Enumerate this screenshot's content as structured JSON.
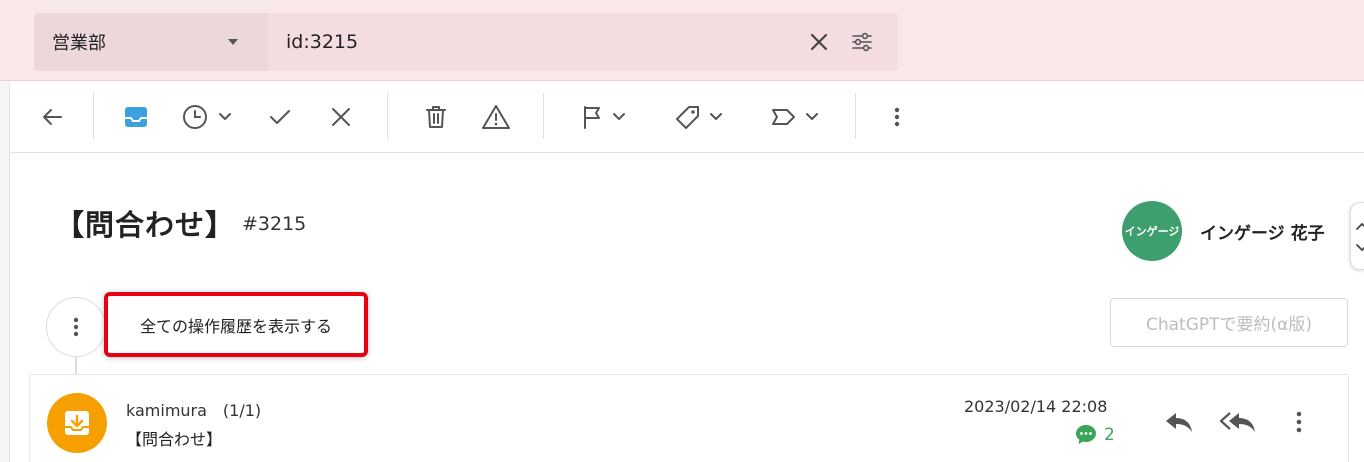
{
  "search": {
    "department": "営業部",
    "query": "id:3215"
  },
  "toolbar": {
    "back_icon": "arrow-left-icon",
    "inbox_icon": "inbox-icon",
    "snooze_icon": "clock-icon",
    "done_icon": "check-icon",
    "close_icon": "x-icon",
    "trash_icon": "trash-icon",
    "spam_icon": "warning-icon",
    "flag_icon": "flag-icon",
    "tag_icon": "tag-icon",
    "label_icon": "label-icon",
    "more_icon": "more-vertical-icon",
    "accent_color": "#3aa0de"
  },
  "ticket": {
    "title": "【問合わせ】",
    "id": "#3215",
    "assignee_avatar": "インゲージ",
    "assignee_name": "インゲージ 花子",
    "avatar_color": "#3d9e6e"
  },
  "history": {
    "show_all_label": "全ての操作履歴を表示する",
    "chatgpt_label": "ChatGPTで要約(α版)"
  },
  "message": {
    "sender": "kamimura　(1/1)",
    "subject": "【問合わせ】",
    "date": "2023/02/14 22:08",
    "comment_count": "2",
    "icon_color": "#f5a000",
    "comment_color": "#3aa55a"
  }
}
